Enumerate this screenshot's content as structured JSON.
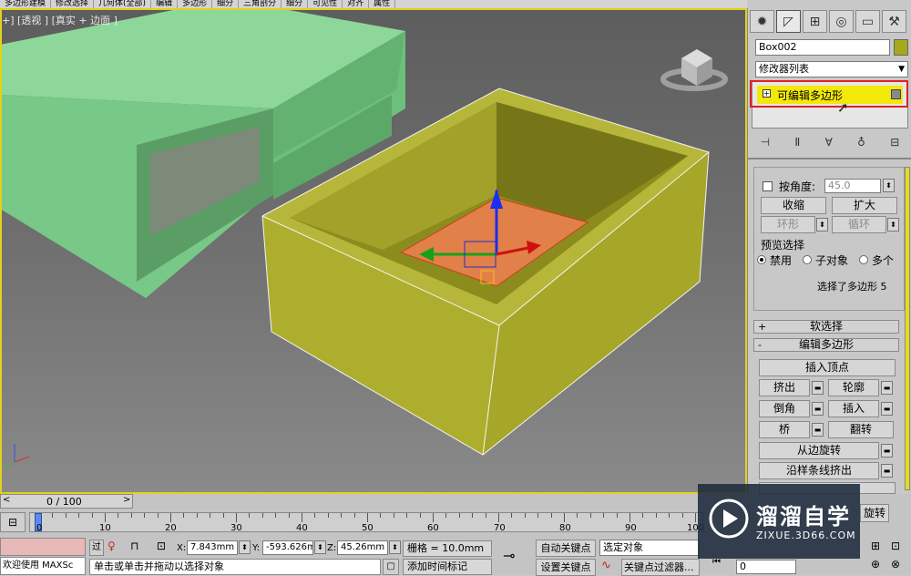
{
  "menubar": [
    "多边形建模",
    "修改选择",
    "几何体(全部)",
    "编辑",
    "多边形",
    "细分",
    "三角剖分",
    "细分",
    "可见性",
    "对齐",
    "属性"
  ],
  "viewport": {
    "label": "+] [透视 ] [真实 + 边面 ]"
  },
  "command_panel": {
    "object_name": "Box002",
    "object_color": "#a8a81e",
    "modifier_list": "修改器列表",
    "stack_item": "可编辑多边形",
    "selection": {
      "by_angle_label": "按角度:",
      "by_angle_value": "45.0",
      "shrink": "收缩",
      "grow": "扩大",
      "ring": "环形",
      "loop": "循环",
      "preview_group": "预览选择",
      "preview_off": "禁用",
      "preview_subobj": "子对象",
      "preview_multi": "多个",
      "status": "选择了多边形 5"
    },
    "soft_selection": "软选择",
    "edit_polygons": "编辑多边形",
    "insert_vertex": "插入顶点",
    "extrude": "挤出",
    "outline": "轮廓",
    "bevel": "倒角",
    "inset": "插入",
    "bridge": "桥",
    "flip": "翻转",
    "hinge_from_edge": "从边旋转",
    "extrude_along_spline": "沿样条线挤出",
    "rotate_partial": "旋转"
  },
  "timeline": {
    "frame_counter": "0 / 100",
    "ticks": [
      "0",
      "10",
      "20",
      "30",
      "40",
      "50",
      "60",
      "70",
      "80",
      "90",
      "100"
    ]
  },
  "status": {
    "welcome": "欢迎使用 MAXSc",
    "prompt": "单击或单击并拖动以选择对象",
    "x_label": "X:",
    "x_value": "7.843mm",
    "y_label": "Y:",
    "y_value": "-593.626m",
    "z_label": "Z:",
    "z_value": "45.26mm",
    "grid": "栅格 = 10.0mm",
    "auto_key": "自动关键点",
    "set_key": "设置关键点",
    "selected_object": "选定对象",
    "key_filters": "关键点过滤器...",
    "add_time_tag": "添加时间标记",
    "frame_value": "0"
  },
  "watermark": {
    "title": "溜溜自学",
    "url": "ZIXUE.3D66.COM"
  }
}
